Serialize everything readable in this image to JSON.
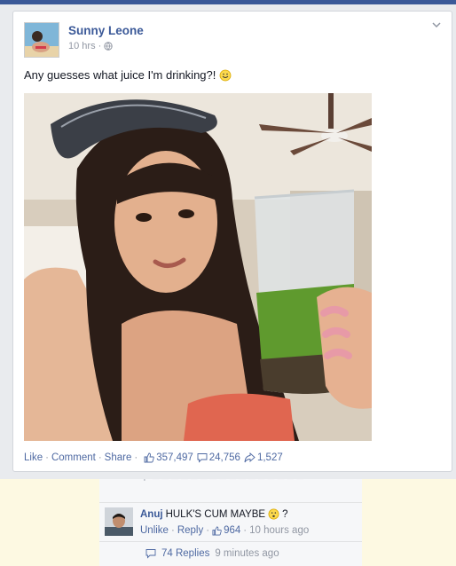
{
  "post": {
    "author": "Sunny Leone",
    "time": "10 hrs",
    "visibility_icon": "globe-icon",
    "status_text": "Any guesses what juice I'm drinking?!",
    "emoji": "smiley-emoji",
    "photo_description": "",
    "actions": {
      "like": "Like",
      "comment": "Comment",
      "share": "Share"
    },
    "stats": {
      "likes": "357,497",
      "comments": "24,756",
      "shares": "1,527"
    }
  },
  "comment": {
    "author": "Anuj",
    "text": "HULK'S CUM MAYBE",
    "emoji": "confused-emoji",
    "text_after": "?",
    "unlike": "Unlike",
    "reply": "Reply",
    "likes": "964",
    "time": "10 hours ago",
    "replies_label": "74 Replies",
    "replies_time": "9 minutes ago"
  },
  "colors": {
    "brand": "#3b5998",
    "link": "#4e69a2",
    "muted": "#9197a3",
    "highlight": "#fdf9e2"
  }
}
